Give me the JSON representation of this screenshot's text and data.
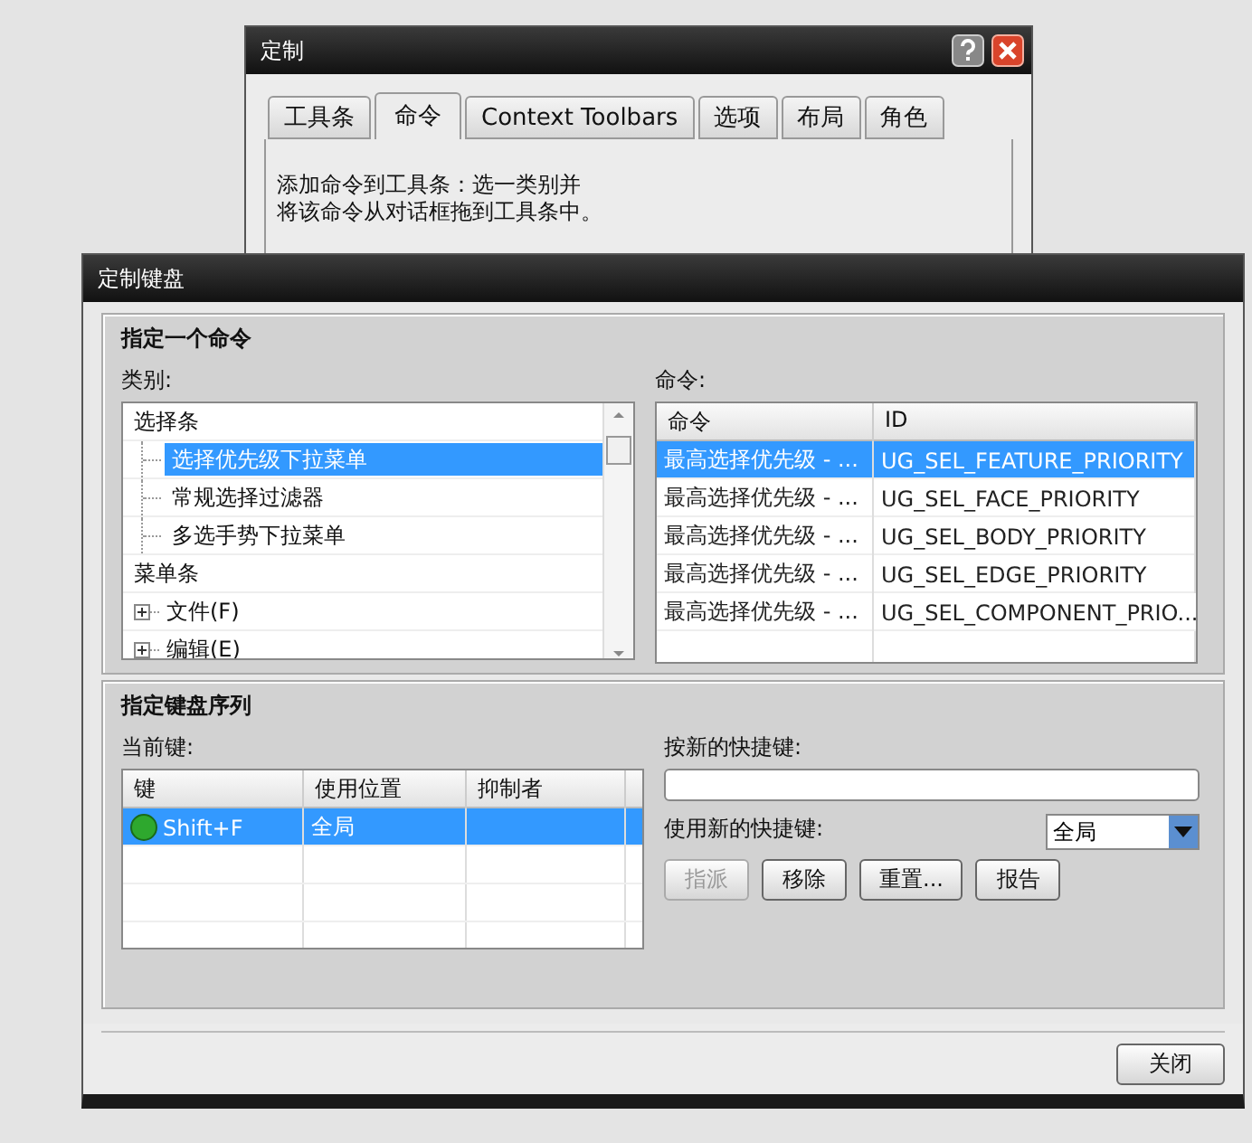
{
  "back_window": {
    "title": "定制",
    "tabs": [
      {
        "label": "工具条",
        "selected": false
      },
      {
        "label": "命令",
        "selected": true
      },
      {
        "label": "Context Toolbars",
        "selected": false
      },
      {
        "label": "选项",
        "selected": false
      },
      {
        "label": "布局",
        "selected": false
      },
      {
        "label": "角色",
        "selected": false
      }
    ],
    "description_lines": [
      "添加命令到工具条：选一类别并",
      "将该命令从对话框拖到工具条中。"
    ]
  },
  "window": {
    "title": "定制键盘",
    "command_section": {
      "title": "指定一个命令",
      "category_label": "类别:",
      "category_tree": [
        {
          "label": "选择条",
          "selected": false,
          "children": [
            {
              "label": "选择优先级下拉菜单",
              "selected": true
            },
            {
              "label": "常规选择过滤器",
              "selected": false
            },
            {
              "label": "多选手势下拉菜单",
              "selected": false
            }
          ]
        },
        {
          "label": "菜单条",
          "selected": false,
          "children": [
            {
              "label": "文件(F)",
              "selected": false,
              "expanded": false
            },
            {
              "label": "编辑(E)",
              "selected": false,
              "expanded": false
            }
          ]
        }
      ],
      "command_label": "命令:",
      "command_table": {
        "columns": [
          "命令",
          "ID"
        ],
        "rows": [
          {
            "cells": [
              "最高选择优先级 - ...",
              "UG_SEL_FEATURE_PRIORITY"
            ],
            "selected": true
          },
          {
            "cells": [
              "最高选择优先级 - ...",
              "UG_SEL_FACE_PRIORITY"
            ],
            "selected": false
          },
          {
            "cells": [
              "最高选择优先级 - ...",
              "UG_SEL_BODY_PRIORITY"
            ],
            "selected": false
          },
          {
            "cells": [
              "最高选择优先级 - ...",
              "UG_SEL_EDGE_PRIORITY"
            ],
            "selected": false
          },
          {
            "cells": [
              "最高选择优先级 - ...",
              "UG_SEL_COMPONENT_PRIO..."
            ],
            "selected": false
          }
        ]
      }
    },
    "key_section": {
      "title": "指定键盘序列",
      "current_keys_label": "当前键:",
      "keys_table": {
        "columns": [
          "键",
          "使用位置",
          "抑制者"
        ],
        "rows": [
          {
            "cells": [
              "Shift+F",
              "全局",
              ""
            ],
            "selected": true
          }
        ]
      },
      "new_shortcut_label": "按新的快捷键:",
      "use_label": "使用新的快捷键:",
      "scope_select": {
        "value": "全局"
      },
      "buttons": [
        {
          "label": "指派",
          "disabled": true
        },
        {
          "label": "移除",
          "disabled": false
        },
        {
          "label": "重置...",
          "disabled": false
        },
        {
          "label": "报告",
          "disabled": false
        }
      ]
    },
    "close_button": "关闭"
  }
}
